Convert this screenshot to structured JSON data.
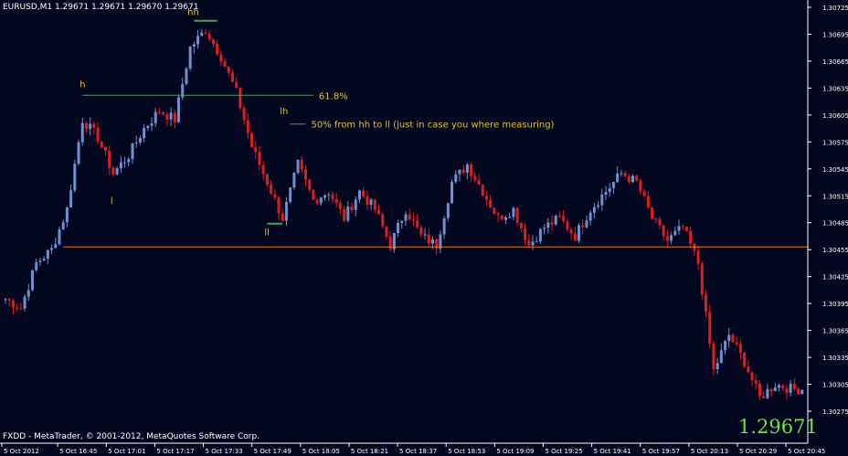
{
  "header": {
    "symbol_info": "EURUSD,M1  1.29671 1.29671 1.29670 1.29671"
  },
  "footer": {
    "copyright": "FXDD - MetaTrader, © 2001-2012, MetaQuotes Software Corp."
  },
  "current_price_label": "1.29671",
  "colors": {
    "background": "#02071f",
    "bull": "#6f8fcf",
    "bear": "#e01c1c",
    "grid_axis": "#ffffff",
    "annotation": "#e0c040",
    "green_line": "#40a060",
    "support_line": "#e07a30",
    "price_label": "#70e040"
  },
  "chart_data": {
    "type": "candlestick",
    "title": "",
    "instrument": "EURUSD,M1",
    "ohlc_header": [
      1.29671,
      1.29671,
      1.2967,
      1.29671
    ],
    "y_ticks": [
      "1.30725",
      "1.30695",
      "1.30665",
      "1.30635",
      "1.30605",
      "1.30575",
      "1.30545",
      "1.30515",
      "1.30485",
      "1.30455",
      "1.30425",
      "1.30395",
      "1.30365",
      "1.30335",
      "1.30305",
      "1.30275"
    ],
    "x_ticks": [
      "5 Oct 2012",
      "5 Oct 16:45",
      "5 Oct 17:01",
      "5 Oct 17:17",
      "5 Oct 17:33",
      "5 Oct 17:49",
      "5 Oct 18:05",
      "5 Oct 18:21",
      "5 Oct 18:37",
      "5 Oct 18:53",
      "5 Oct 19:09",
      "5 Oct 19:25",
      "5 Oct 19:41",
      "5 Oct 19:57",
      "5 Oct 20:13",
      "5 Oct 20:29",
      "5 Oct 20:45"
    ],
    "ylim": [
      1.3027,
      1.30735
    ],
    "grid": false,
    "close_path": [
      [
        0,
        1.304
      ],
      [
        4,
        1.3039
      ],
      [
        8,
        1.3044
      ],
      [
        12,
        1.30455
      ],
      [
        16,
        1.305
      ],
      [
        20,
        1.306
      ],
      [
        24,
        1.3058
      ],
      [
        28,
        1.3054
      ],
      [
        32,
        1.3056
      ],
      [
        36,
        1.3059
      ],
      [
        40,
        1.3061
      ],
      [
        44,
        1.306
      ],
      [
        48,
        1.3068
      ],
      [
        52,
        1.307
      ],
      [
        56,
        1.3067
      ],
      [
        60,
        1.3063
      ],
      [
        64,
        1.3057
      ],
      [
        68,
        1.3053
      ],
      [
        72,
        1.3049
      ],
      [
        76,
        1.3055
      ],
      [
        80,
        1.3051
      ],
      [
        84,
        1.3052
      ],
      [
        88,
        1.3049
      ],
      [
        92,
        1.3052
      ],
      [
        96,
        1.305
      ],
      [
        100,
        1.3046
      ],
      [
        104,
        1.305
      ],
      [
        108,
        1.3047
      ],
      [
        112,
        1.3046
      ],
      [
        116,
        1.3053
      ],
      [
        120,
        1.3055
      ],
      [
        124,
        1.3052
      ],
      [
        128,
        1.3049
      ],
      [
        132,
        1.305
      ],
      [
        136,
        1.3046
      ],
      [
        140,
        1.3048
      ],
      [
        144,
        1.3049
      ],
      [
        148,
        1.3047
      ],
      [
        152,
        1.305
      ],
      [
        156,
        1.3052
      ],
      [
        160,
        1.3054
      ],
      [
        164,
        1.3053
      ],
      [
        168,
        1.3049
      ],
      [
        172,
        1.30465
      ],
      [
        176,
        1.3048
      ],
      [
        180,
        1.3044
      ],
      [
        184,
        1.3032
      ],
      [
        188,
        1.3036
      ],
      [
        192,
        1.3033
      ],
      [
        196,
        1.3029
      ],
      [
        200,
        1.30305
      ],
      [
        204,
        1.303
      ]
    ],
    "current_price": 1.29671,
    "annotations": [
      {
        "label": "hh",
        "x_index": 48,
        "price": 1.3071
      },
      {
        "label": "h",
        "x_index": 20,
        "price": 1.3063
      },
      {
        "label": "l",
        "x_index": 28,
        "price": 1.305
      },
      {
        "label": "lh",
        "x_index": 72,
        "price": 1.306
      },
      {
        "label": "ll",
        "x_index": 68,
        "price": 1.30465
      }
    ],
    "levels": [
      {
        "label": "61.8%",
        "price": 1.30627,
        "from_index": 20,
        "to_index": 80
      },
      {
        "label": "50% from hh to ll (just in case you where measuring)",
        "price": 1.30595,
        "from_index": 74,
        "to_index": 78
      },
      {
        "label": "",
        "price": 1.30458,
        "from_index": 15,
        "to_index": 207,
        "style": "support"
      }
    ]
  }
}
